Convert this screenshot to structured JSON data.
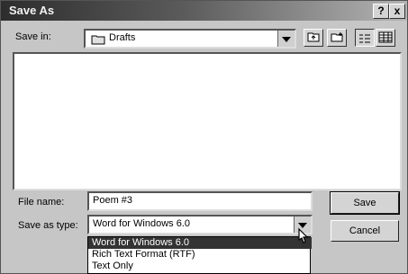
{
  "window": {
    "title": "Save As",
    "help_button": "?",
    "close_button": "x"
  },
  "save_in": {
    "label": "Save in:",
    "folder": "Drafts"
  },
  "file_name": {
    "label": "File name:",
    "value": "Poem #3"
  },
  "save_as_type": {
    "label": "Save as type:",
    "value": "Word for Windows 6.0",
    "options": [
      "Word for Windows 6.0",
      "Rich Text Format (RTF)",
      "Text Only"
    ]
  },
  "buttons": {
    "save": "Save",
    "cancel": "Cancel"
  },
  "icons": [
    "folder-icon",
    "up-one-level-icon",
    "new-folder-icon",
    "list-view-icon",
    "details-view-icon",
    "chevron-down-icon",
    "mouse-pointer-icon"
  ]
}
